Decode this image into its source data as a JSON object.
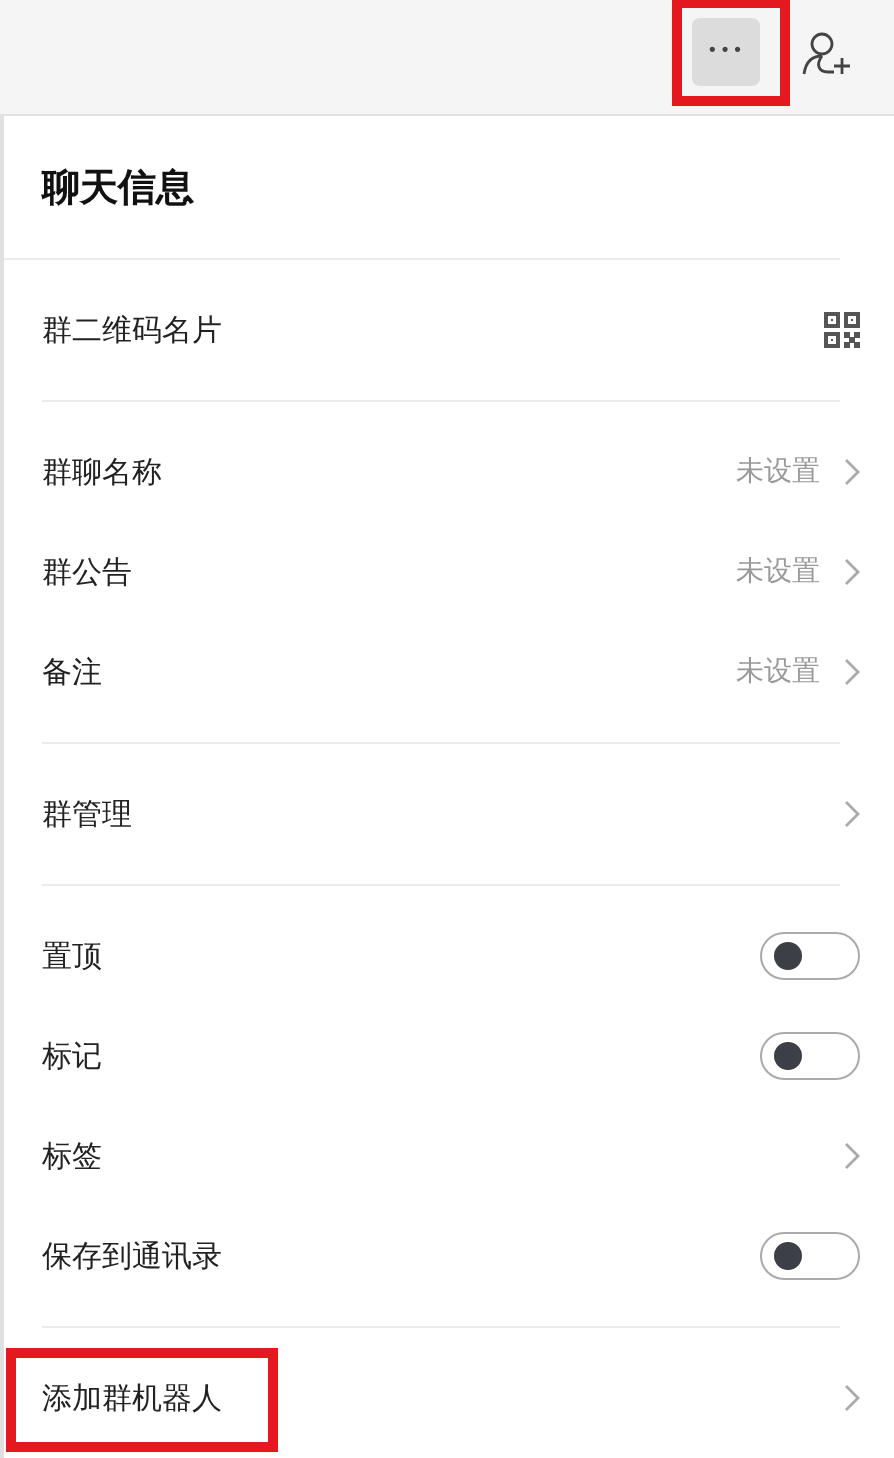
{
  "top_bar": {
    "more_button": {
      "label": "•••",
      "highlighted": true
    }
  },
  "title": "聊天信息",
  "sections": [
    [
      {
        "kind": "qr",
        "label": "群二维码名片",
        "highlighted": false
      }
    ],
    [
      {
        "kind": "link",
        "label": "群聊名称",
        "value": "未设置",
        "highlighted": false
      },
      {
        "kind": "link",
        "label": "群公告",
        "value": "未设置",
        "highlighted": false
      },
      {
        "kind": "link",
        "label": "备注",
        "value": "未设置",
        "highlighted": false
      }
    ],
    [
      {
        "kind": "link",
        "label": "群管理",
        "highlighted": false
      }
    ],
    [
      {
        "kind": "toggle",
        "label": "置顶",
        "on": false,
        "highlighted": false
      },
      {
        "kind": "toggle",
        "label": "标记",
        "on": false,
        "highlighted": false
      },
      {
        "kind": "link",
        "label": "标签",
        "highlighted": false
      },
      {
        "kind": "toggle",
        "label": "保存到通讯录",
        "on": false,
        "highlighted": false
      }
    ],
    [
      {
        "kind": "link",
        "label": "添加群机器人",
        "highlighted": true
      }
    ]
  ]
}
